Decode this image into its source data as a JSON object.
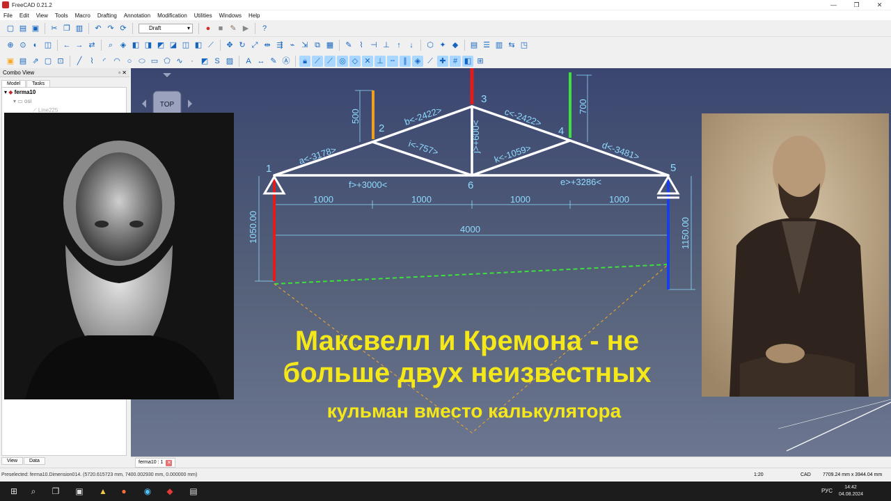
{
  "window": {
    "title": "FreeCAD 0.21.2",
    "min": "—",
    "max": "❐",
    "close": "✕"
  },
  "menu": [
    "File",
    "Edit",
    "View",
    "Tools",
    "Macro",
    "Drafting",
    "Annotation",
    "Modification",
    "Utilities",
    "Windows",
    "Help"
  ],
  "workbench": {
    "selected": "Draft"
  },
  "combo_view": {
    "title": "Combo View",
    "tabs": [
      "Model",
      "Tasks"
    ],
    "tree": [
      {
        "indent": 0,
        "label": "ferma10"
      },
      {
        "indent": 1,
        "label": "osi"
      },
      {
        "indent": 2,
        "label": "Line225"
      }
    ],
    "bottom_tabs": [
      "View",
      "Data"
    ]
  },
  "doc_tab": {
    "label": "ferma10 : 1"
  },
  "navcube": {
    "face": "TOP"
  },
  "truss": {
    "nodes": [
      {
        "id": "1",
        "label": "1"
      },
      {
        "id": "2",
        "label": "2"
      },
      {
        "id": "3",
        "label": "3"
      },
      {
        "id": "4",
        "label": "4"
      },
      {
        "id": "5",
        "label": "5"
      },
      {
        "id": "6",
        "label": "6"
      }
    ],
    "members": [
      {
        "label": "a<-3178>"
      },
      {
        "label": "b<-2422>"
      },
      {
        "label": "c<-2422>"
      },
      {
        "label": "d<-3481>"
      },
      {
        "label": "i<-757>"
      },
      {
        "label": "j>+600<"
      },
      {
        "label": "k<-1059>"
      },
      {
        "label": "f>+3000<"
      },
      {
        "label": "e>+3286<"
      }
    ],
    "dimensions": {
      "spans": [
        "1000",
        "1000",
        "1000",
        "1000"
      ],
      "total": "4000",
      "load_left": "500",
      "load_right": "700",
      "reaction_left": "1050.00",
      "reaction_right": "1150.00"
    }
  },
  "caption": {
    "line1": "Максвелл и Кремона - не",
    "line2": "больше двух неизвестных",
    "line3": "кульман вместо калькулятора"
  },
  "status": {
    "message": "Preselected: ferma10.Dimension014. (5720.615723 mm, 7400.002930 mm, 0.000000 mm)",
    "scale": "1:20",
    "nav_style": "CAD",
    "dimensions": "7709.24 mm x 3944.04 mm"
  },
  "taskbar": {
    "lang": "РУС",
    "time": "14:42",
    "date": "04.08.2024"
  }
}
